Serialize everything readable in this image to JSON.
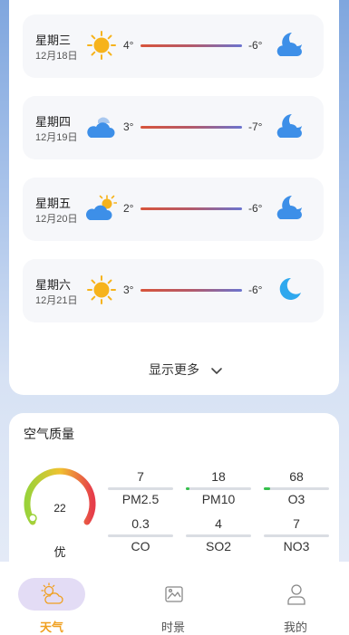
{
  "forecast": {
    "days": [
      {
        "name": "星期三",
        "date": "12月18日",
        "high": "4°",
        "low": "-6°",
        "day_icon": "sun-icon",
        "night_icon": "moon-cloud-icon"
      },
      {
        "name": "星期四",
        "date": "12月19日",
        "high": "3°",
        "low": "-7°",
        "day_icon": "cloud-icon",
        "night_icon": "moon-cloud-icon"
      },
      {
        "name": "星期五",
        "date": "12月20日",
        "high": "2°",
        "low": "-6°",
        "day_icon": "partly-cloudy-icon",
        "night_icon": "moon-cloud-icon"
      },
      {
        "name": "星期六",
        "date": "12月21日",
        "high": "3°",
        "low": "-6°",
        "day_icon": "sun-icon",
        "night_icon": "moon-icon"
      }
    ],
    "show_more": "显示更多"
  },
  "air_quality": {
    "title": "空气质量",
    "aqi": "22",
    "category": "优",
    "gauge_level": 0.07,
    "metrics": [
      {
        "value": "7",
        "name": "PM2.5",
        "level": 0.0
      },
      {
        "value": "18",
        "name": "PM10",
        "level": 0.04
      },
      {
        "value": "68",
        "name": "O3",
        "level": 0.1
      },
      {
        "value": "0.3",
        "name": "CO",
        "level": 0.0
      },
      {
        "value": "4",
        "name": "SO2",
        "level": 0.0
      },
      {
        "value": "7",
        "name": "NO3",
        "level": 0.0
      }
    ]
  },
  "nav": {
    "items": [
      {
        "label": "天气",
        "icon": "weather-icon",
        "active": true
      },
      {
        "label": "时景",
        "icon": "picture-icon",
        "active": false
      },
      {
        "label": "我的",
        "icon": "user-icon",
        "active": false
      }
    ]
  },
  "colors": {
    "accent": "#f0a020",
    "sun": "#f6b31c",
    "cloud": "#3d8fe8",
    "good": "#35c04c"
  }
}
